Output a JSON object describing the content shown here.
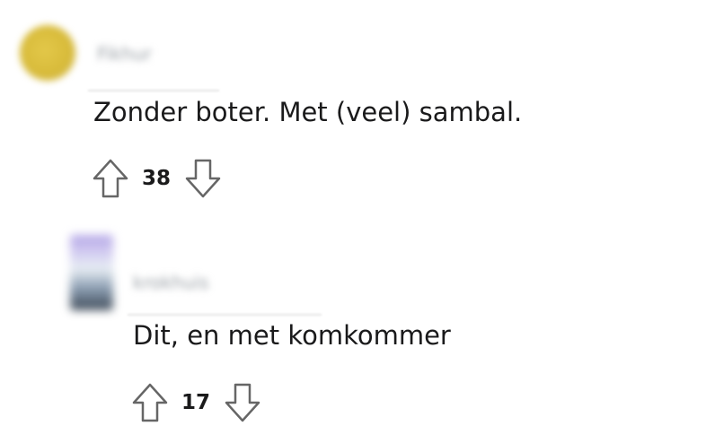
{
  "comments": [
    {
      "username": "Fikhur",
      "body": "Zonder boter. Met (veel) sambal.",
      "score": "38"
    },
    {
      "username": "krokhuis",
      "body": "Dit, en met komkommer",
      "score": "17"
    }
  ],
  "icons": {
    "upvote": "arrow-up-outline-icon",
    "downvote": "arrow-down-outline-icon"
  },
  "colors": {
    "text": "#1a1a1b",
    "vote_icon": "#666666"
  }
}
